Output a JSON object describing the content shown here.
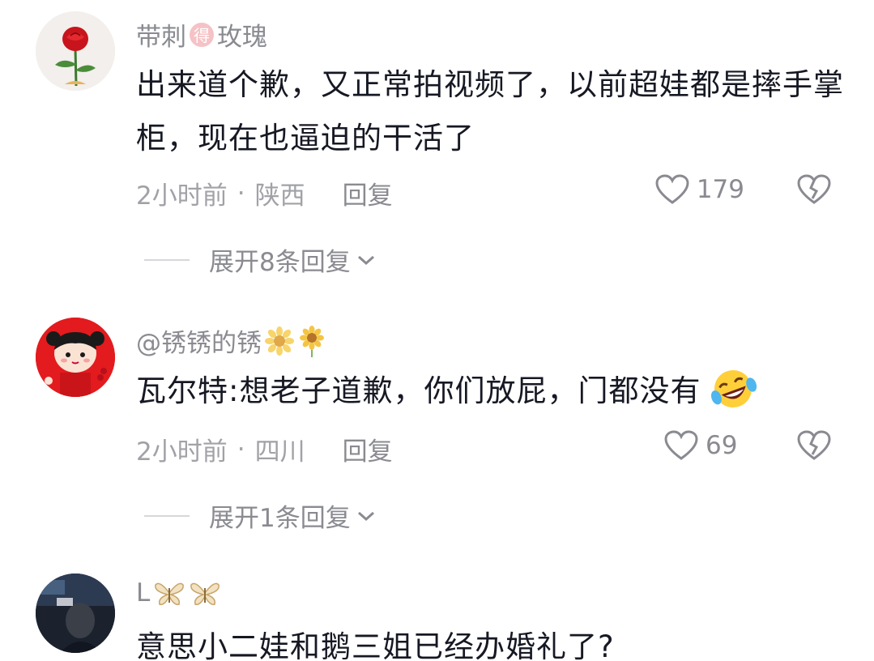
{
  "comments": [
    {
      "username_parts": [
        "带刺",
        "得",
        "玫瑰"
      ],
      "text": "出来道个歉，又正常拍视频了，以前超娃都是摔手掌柜，现在也逼迫的干活了",
      "time": "2小时前",
      "location": "陕西",
      "reply_label": "回复",
      "likes": "179",
      "expand_label": "展开8条回复"
    },
    {
      "username": "@锈锈的锈",
      "text": "瓦尔特:想老子道歉，你们放屁，门都没有",
      "time": "2小时前",
      "location": "四川",
      "reply_label": "回复",
      "likes": "69",
      "expand_label": "展开1条回复"
    },
    {
      "username": "L",
      "text": "意思小二娃和鹅三姐已经办婚礼了?"
    }
  ],
  "separator": "·",
  "icons": [
    "rose-avatar",
    "girl-avatar",
    "dark-photo-avatar",
    "heart-icon",
    "broken-heart-icon",
    "chevron-down-icon",
    "sunflower-icon",
    "butterfly-icon",
    "laughing-tears-emoji"
  ]
}
